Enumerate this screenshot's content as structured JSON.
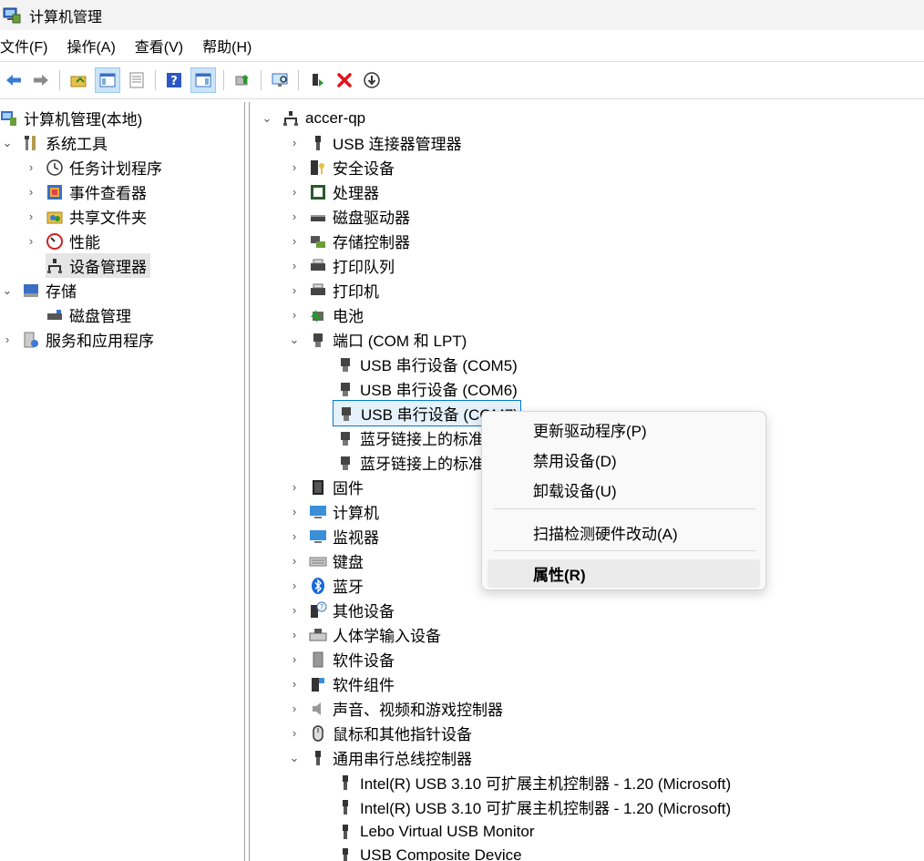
{
  "window": {
    "title": "计算机管理"
  },
  "menu": [
    "文件(F)",
    "操作(A)",
    "查看(V)",
    "帮助(H)"
  ],
  "left_tree": [
    {
      "label": "计算机管理(本地)",
      "icon": "computer-management-icon"
    },
    {
      "label": "系统工具",
      "icon": "tools-icon"
    },
    {
      "label": "任务计划程序",
      "icon": "clock-icon"
    },
    {
      "label": "事件查看器",
      "icon": "event-viewer-icon"
    },
    {
      "label": "共享文件夹",
      "icon": "shared-folder-icon"
    },
    {
      "label": "性能",
      "icon": "performance-icon"
    },
    {
      "label": "设备管理器",
      "icon": "device-manager-icon"
    },
    {
      "label": "存储",
      "icon": "storage-icon"
    },
    {
      "label": "磁盘管理",
      "icon": "disk-management-icon"
    },
    {
      "label": "服务和应用程序",
      "icon": "services-icon"
    }
  ],
  "device_tree": {
    "root": "accer-qp",
    "items": [
      {
        "label": "USB 连接器管理器",
        "icon": "usb-connector-icon"
      },
      {
        "label": "安全设备",
        "icon": "security-device-icon"
      },
      {
        "label": "处理器",
        "icon": "processor-icon"
      },
      {
        "label": "磁盘驱动器",
        "icon": "disk-drive-icon"
      },
      {
        "label": "存储控制器",
        "icon": "storage-controller-icon"
      },
      {
        "label": "打印队列",
        "icon": "print-queue-icon"
      },
      {
        "label": "打印机",
        "icon": "printer-icon"
      },
      {
        "label": "电池",
        "icon": "battery-icon"
      },
      {
        "label": "端口 (COM 和 LPT)",
        "icon": "port-icon"
      },
      {
        "label": "USB 串行设备 (COM5)",
        "icon": "port-icon"
      },
      {
        "label": "USB 串行设备 (COM6)",
        "icon": "port-icon"
      },
      {
        "label": "USB 串行设备 (COM7)",
        "icon": "port-icon"
      },
      {
        "label": "蓝牙链接上的标准串行 (COM3)",
        "icon": "port-icon"
      },
      {
        "label": "蓝牙链接上的标准串行 (COM4)",
        "icon": "port-icon"
      },
      {
        "label": "固件",
        "icon": "firmware-icon"
      },
      {
        "label": "计算机",
        "icon": "computer-icon"
      },
      {
        "label": "监视器",
        "icon": "monitor-icon"
      },
      {
        "label": "键盘",
        "icon": "keyboard-icon"
      },
      {
        "label": "蓝牙",
        "icon": "bluetooth-icon"
      },
      {
        "label": "其他设备",
        "icon": "other-devices-icon"
      },
      {
        "label": "人体学输入设备",
        "icon": "hid-icon"
      },
      {
        "label": "软件设备",
        "icon": "software-device-icon"
      },
      {
        "label": "软件组件",
        "icon": "software-component-icon"
      },
      {
        "label": "声音、视频和游戏控制器",
        "icon": "sound-icon"
      },
      {
        "label": "鼠标和其他指针设备",
        "icon": "mouse-icon"
      },
      {
        "label": "通用串行总线控制器",
        "icon": "usb-icon"
      },
      {
        "label": "Intel(R) USB 3.10 可扩展主机控制器 - 1.20 (Microsoft)",
        "icon": "usb-icon"
      },
      {
        "label": "Intel(R) USB 3.10 可扩展主机控制器 - 1.20 (Microsoft)",
        "icon": "usb-icon"
      },
      {
        "label": "Lebo Virtual USB Monitor",
        "icon": "usb-icon"
      },
      {
        "label": "USB Composite Device",
        "icon": "usb-icon"
      }
    ]
  },
  "context_menu": {
    "items": [
      "更新驱动程序(P)",
      "禁用设备(D)",
      "卸载设备(U)",
      "扫描检测硬件改动(A)",
      "属性(R)"
    ]
  }
}
